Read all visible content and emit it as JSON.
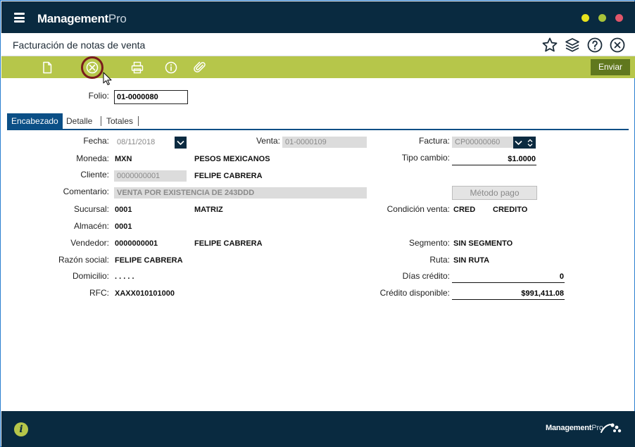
{
  "app": {
    "brand_bold": "Management",
    "brand_light": "Pro"
  },
  "window": {
    "colors": {
      "minimize": "#e8e21c",
      "maximize": "#a7c33a",
      "close": "#e0566a"
    }
  },
  "page": {
    "title": "Facturación de notas de venta"
  },
  "toolbar": {
    "send_label": "Enviar",
    "accent": "#b6c64a"
  },
  "form": {
    "folio_label": "Folio:",
    "folio_value": "01-0000080",
    "tabs": [
      {
        "label": "Encabezado",
        "active": true
      },
      {
        "label": "Detalle",
        "active": false
      },
      {
        "label": "Totales",
        "active": false
      }
    ],
    "fecha_label": "Fecha:",
    "fecha_value": "08/11/2018",
    "venta_label": "Venta:",
    "venta_value": "01-0000109",
    "factura_label": "Factura:",
    "factura_value": "CP00000060",
    "moneda_label": "Moneda:",
    "moneda_code": "MXN",
    "moneda_name": "PESOS MEXICANOS",
    "tipo_cambio_label": "Tipo cambio:",
    "tipo_cambio_value": "$1.0000",
    "cliente_label": "Cliente:",
    "cliente_code": "0000000001",
    "cliente_name": "FELIPE CABRERA",
    "comentario_label": "Comentario:",
    "comentario_value": "VENTA POR EXISTENCIA DE 243DDD",
    "metodo_pago_label": "Método pago",
    "sucursal_label": "Sucursal:",
    "sucursal_code": "0001",
    "sucursal_name": "MATRIZ",
    "condicion_label": "Condición venta:",
    "condicion_code": "CRED",
    "condicion_name": "CREDITO",
    "almacen_label": "Almacén:",
    "almacen_value": "0001",
    "vendedor_label": "Vendedor:",
    "vendedor_code": "0000000001",
    "vendedor_name": "FELIPE CABRERA",
    "segmento_label": "Segmento:",
    "segmento_value": "SIN SEGMENTO",
    "razon_label": "Razón social:",
    "razon_value": "FELIPE CABRERA",
    "ruta_label": "Ruta:",
    "ruta_value": "SIN RUTA",
    "domicilio_label": "Domicilio:",
    "domicilio_value": ". . . . .",
    "dias_label": "Días crédito:",
    "dias_value": "0",
    "rfc_label": "RFC:",
    "rfc_value": "XAXX010101000",
    "credito_label": "Crédito disponible:",
    "credito_value": "$991,411.08"
  },
  "footer": {
    "brand_bold": "Management",
    "brand_light": "Pro",
    "info_glyph": "i"
  }
}
